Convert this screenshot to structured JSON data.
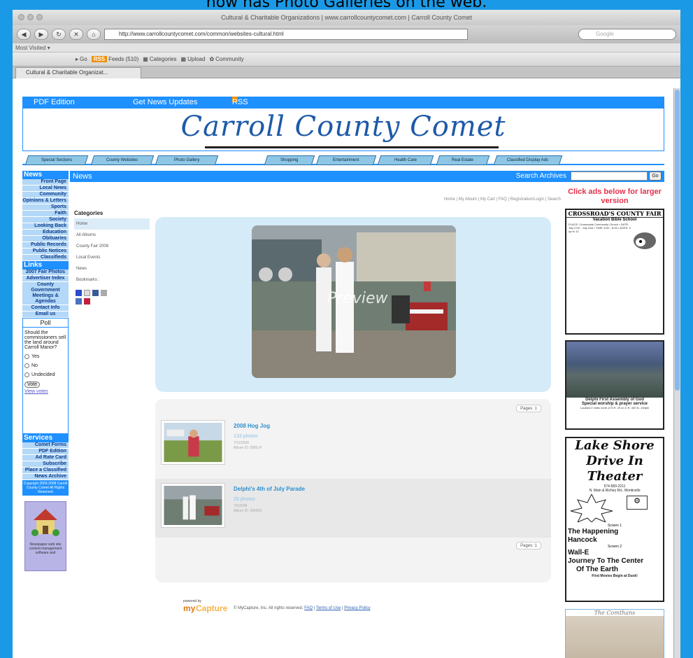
{
  "caption": "now has Photo Galleries on the web.",
  "browser": {
    "window_title": "Cultural & Charitable Organizations | www.carrollcountycomet.com | Carroll County Comet",
    "url": "http://www.carrollcountycomet.com/common/websites-cultural.html",
    "search_placeholder": "Google",
    "most_visited": "Most Visited ▾",
    "toolbar": {
      "go": "Go",
      "feeds": "Feeds (510)",
      "categories": "Categories",
      "upload": "Upload",
      "community": "Community"
    },
    "tab_label": "Cultural & Charitable Organizat..."
  },
  "site": {
    "top_links": [
      "PDF Edition",
      "Get News Updates",
      "RSS Feed"
    ],
    "banner_title": "Carroll County Comet",
    "sections": [
      "Special Sections",
      "County Websites",
      "Photo Gallery",
      "Shopping",
      "Entertainment",
      "Health Care",
      "Real Estate",
      "Classified Display Ads"
    ],
    "news_heading": "News",
    "search_archives": "Search Archives",
    "go_button": "Go"
  },
  "left_nav": {
    "news_heading": "News",
    "news_items": [
      "Front Page",
      "Local News",
      "Community",
      "Opinions & Letters",
      "Sports",
      "Faith",
      "Society",
      "Looking Back",
      "Education",
      "Obituaries",
      "Public Records",
      "Public Notices",
      "Classifieds"
    ],
    "links_heading": "Links",
    "links_items": [
      "2007 Fair Photos",
      "Advertiser Index",
      "County Government Meetings & Agendas",
      "Contact Info",
      "Email us"
    ],
    "poll": {
      "title": "Poll",
      "question": "Should the commissioners sell the land around Carroll Manor?",
      "options": [
        "Yes",
        "No",
        "Undecided"
      ],
      "vote": "Vote",
      "view_votes": "View votes"
    },
    "services_heading": "Services",
    "services_items": [
      "Comet Forms",
      "PDF Edition",
      "Ad Rate Card",
      "Subscribe",
      "Place a Classified",
      "News Archive"
    ],
    "copyright": "Copyright 2003-2008 Carroll County Comet All Rights Reserved",
    "promo_text": "Newspaper web site content management software and"
  },
  "gallery": {
    "top_links": "Home | My Album | My Cart | FAQ | Registration/Login | Search",
    "categories_title": "Categories",
    "categories": [
      "Home",
      "All Albums",
      "County Fair 2008",
      "Local Events",
      "News"
    ],
    "bookmarks_label": "Bookmarks :",
    "preview_label": "Preview",
    "pages_label": "Pages: 1",
    "albums": [
      {
        "title": "2008 Hog Jog",
        "count": "133 photos",
        "date": "7/11/2008",
        "id": "Album ID: 998614"
      },
      {
        "title": "Delphi's 4th of July Parade",
        "count": "29 photos",
        "date": "7/5/2008",
        "id": "Album ID: 995693"
      }
    ],
    "footer": {
      "powered_by": "powered by",
      "logo_my": "my",
      "logo_capture": "Capture",
      "copyright": "© MyCapture, Inc. All rights reserved.",
      "faq": "FAQ",
      "terms": "Terms of Use",
      "privacy": "Privacy Policy"
    }
  },
  "right_ads": {
    "click_ads": "Click ads below for larger version",
    "ad1": {
      "title": "CROSSROAD'S COUNTY FAIR",
      "subtitle": "Vacation Bible School",
      "body": "PLACE: Crossroads Community Church • DATE: July 27th - July 31st • TIME: 6:00 - 8:30 • AGES: 3 up to 12"
    },
    "ad2": {
      "line1": "Delphi First Assembly of God",
      "line2": "Special worship & prayer service",
      "line3": "Located 2 miles north of S.R. 25 on C.R. 400 N., Delphi"
    },
    "ad3": {
      "title1": "Lake Shore",
      "title2": "Drive In Theater",
      "phone": "574-583-2211",
      "address": "N. Main & Richey Rd., Monticello",
      "screen1": "Screen 1",
      "movie1a": "The Happening",
      "movie1b": "Hancock",
      "screen2": "Screen 2",
      "movie2": "Wall-E",
      "movie3a": "Journey To The Center",
      "movie3b": "Of The Earth",
      "note": "First Movies Begin at Dusk!"
    },
    "ad4": {
      "signature": "The Comthans"
    }
  }
}
